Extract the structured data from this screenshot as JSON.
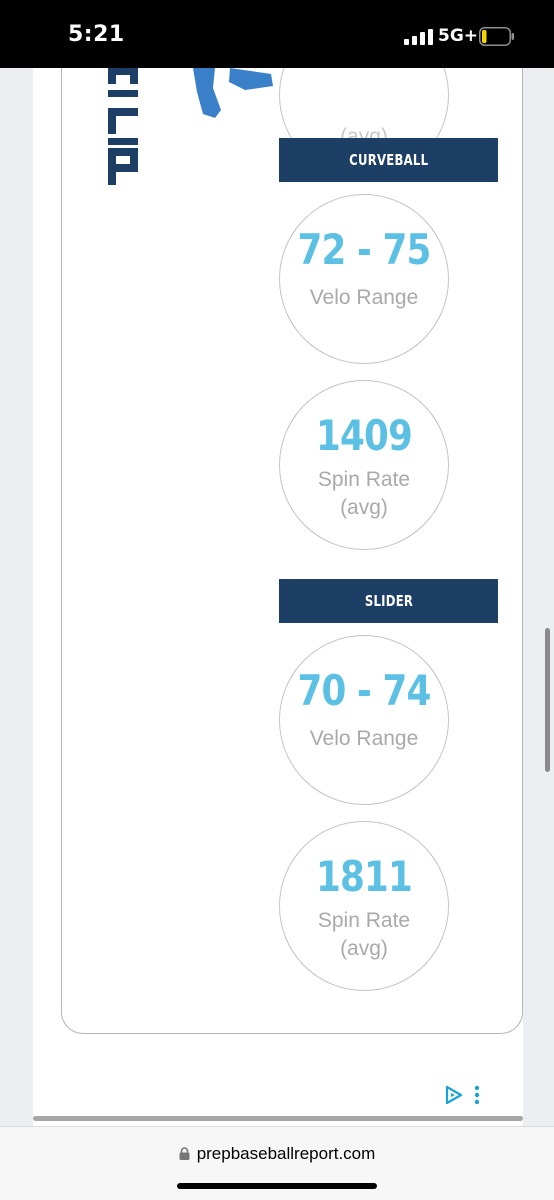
{
  "status_bar": {
    "time": "5:21",
    "network": "5G+",
    "battery_level": 0.12,
    "battery_color": "#f5d300"
  },
  "top_partial": {
    "label": "(avg)"
  },
  "logo": {
    "text": "PITC"
  },
  "pitches": [
    {
      "name": "CURVEBALL",
      "velo_range": "72 - 75",
      "velo_label": "Velo Range",
      "spin_rate": "1409",
      "spin_label_line1": "Spin Rate",
      "spin_label_line2": "(avg)"
    },
    {
      "name": "SLIDER",
      "velo_range": "70 - 74",
      "velo_label": "Velo Range",
      "spin_rate": "1811",
      "spin_label_line1": "Spin Rate",
      "spin_label_line2": "(avg)"
    }
  ],
  "ad": {
    "play_icon": "play-triangle-icon",
    "more_icon": "more-vertical-icon"
  },
  "url_bar": {
    "domain": "prepbaseballreport.com"
  },
  "colors": {
    "header_bg": "#1e3f65",
    "stat_value": "#5bc0e4",
    "stat_label": "#a9a9a9",
    "ad_accent": "#1aa3d8"
  }
}
